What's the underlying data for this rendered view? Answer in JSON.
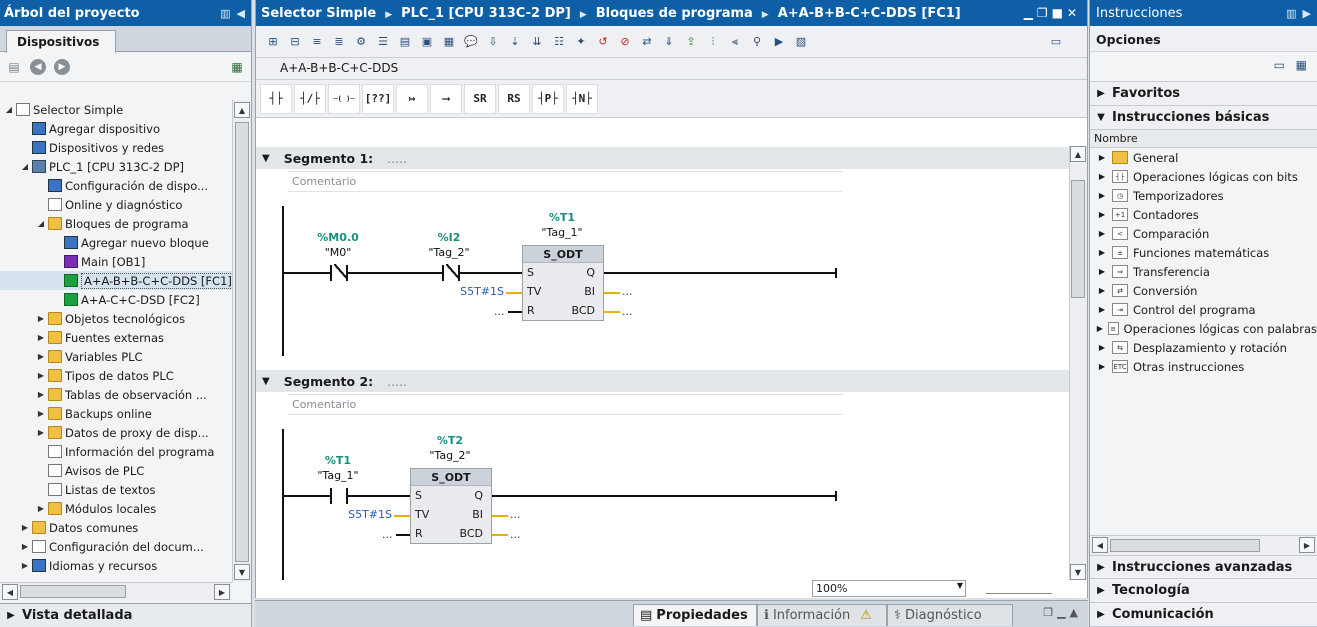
{
  "project_tree": {
    "title": "Árbol del proyecto",
    "tab": "Dispositivos",
    "items": [
      {
        "label": "Selector Simple",
        "level": 0,
        "expander": "open",
        "icon": "doc-icon"
      },
      {
        "label": "Agregar dispositivo",
        "level": 1,
        "expander": "",
        "icon": "add-device-icon"
      },
      {
        "label": "Dispositivos y redes",
        "level": 1,
        "expander": "",
        "icon": "network-icon"
      },
      {
        "label": "PLC_1 [CPU 313C-2 DP]",
        "level": 1,
        "expander": "open",
        "icon": "plc-icon"
      },
      {
        "label": "Configuración de dispo...",
        "level": 2,
        "expander": "",
        "icon": "config-icon"
      },
      {
        "label": "Online y diagnóstico",
        "level": 2,
        "expander": "",
        "icon": "diagnostics-icon"
      },
      {
        "label": "Bloques de programa",
        "level": 2,
        "expander": "open",
        "icon": "folder-icon"
      },
      {
        "label": "Agregar nuevo bloque",
        "level": 3,
        "expander": "",
        "icon": "add-block-icon"
      },
      {
        "label": "Main [OB1]",
        "level": 3,
        "expander": "",
        "icon": "ob-block-icon"
      },
      {
        "label": "A+A-B+B-C+C-DDS [FC1]",
        "level": 3,
        "expander": "",
        "icon": "fc-block-icon",
        "selected": true
      },
      {
        "label": "A+A-C+C-DSD [FC2]",
        "level": 3,
        "expander": "",
        "icon": "fc-block-icon"
      },
      {
        "label": "Objetos tecnológicos",
        "level": 2,
        "expander": "closed",
        "icon": "folder-icon"
      },
      {
        "label": "Fuentes externas",
        "level": 2,
        "expander": "closed",
        "icon": "folder-icon"
      },
      {
        "label": "Variables PLC",
        "level": 2,
        "expander": "closed",
        "icon": "folder-icon"
      },
      {
        "label": "Tipos de datos PLC",
        "level": 2,
        "expander": "closed",
        "icon": "folder-icon"
      },
      {
        "label": "Tablas de observación ...",
        "level": 2,
        "expander": "closed",
        "icon": "folder-icon"
      },
      {
        "label": "Backups online",
        "level": 2,
        "expander": "closed",
        "icon": "folder-icon"
      },
      {
        "label": "Datos de proxy de disp...",
        "level": 2,
        "expander": "closed",
        "icon": "folder-icon"
      },
      {
        "label": "Información del programa",
        "level": 2,
        "expander": "",
        "icon": "program-info-icon"
      },
      {
        "label": "Avisos de PLC",
        "level": 2,
        "expander": "",
        "icon": "alarm-icon"
      },
      {
        "label": "Listas de textos",
        "level": 2,
        "expander": "",
        "icon": "text-list-icon"
      },
      {
        "label": "Módulos locales",
        "level": 2,
        "expander": "closed",
        "icon": "folder-icon"
      },
      {
        "label": "Datos comunes",
        "level": 1,
        "expander": "closed",
        "icon": "folder-icon"
      },
      {
        "label": "Configuración del docum...",
        "level": 1,
        "expander": "closed",
        "icon": "doc-settings-icon"
      },
      {
        "label": "Idiomas y recursos",
        "level": 1,
        "expander": "closed",
        "icon": "languages-icon"
      }
    ],
    "details_view": "Vista detallada"
  },
  "editor": {
    "breadcrumb": [
      "Selector Simple",
      "PLC_1 [CPU 313C-2 DP]",
      "Bloques de programa",
      "A+A-B+B-C+C-DDS [FC1]"
    ],
    "block_name": "A+A-B+B-C+C-DDS",
    "lad_buttons": [
      "┤├",
      "┤/├",
      "─( )─",
      "[??]",
      "↦",
      "⟶",
      "SR",
      "RS",
      "┤P├",
      "┤N├"
    ],
    "comment_placeholder": "Comentario",
    "segments": [
      {
        "title": "Segmento 1:",
        "dots": ".....",
        "contacts": [
          {
            "addr": "%M0.0",
            "name": "\"M0\"",
            "type": "nc"
          },
          {
            "addr": "%I2",
            "name": "\"Tag_2\"",
            "type": "nc"
          }
        ],
        "block": {
          "addr": "%T1",
          "name": "\"Tag_1\"",
          "title": "S_ODT",
          "pins": [
            [
              "S",
              "Q"
            ],
            [
              "TV",
              "BI"
            ],
            [
              "R",
              "BCD"
            ]
          ],
          "tv": "S5T#1S",
          "r": "...",
          "bi": "...",
          "bcd": "..."
        }
      },
      {
        "title": "Segmento 2:",
        "dots": ".....",
        "contacts": [
          {
            "addr": "%T1",
            "name": "\"Tag_1\"",
            "type": "no"
          }
        ],
        "block": {
          "addr": "%T2",
          "name": "\"Tag_2\"",
          "title": "S_ODT",
          "pins": [
            [
              "S",
              "Q"
            ],
            [
              "TV",
              "BI"
            ],
            [
              "R",
              "BCD"
            ]
          ],
          "tv": "S5T#1S",
          "r": "...",
          "bi": "...",
          "bcd": "..."
        }
      }
    ],
    "zoom": "100%"
  },
  "bottom_tabs": [
    "Propiedades",
    "Información",
    "Diagnóstico"
  ],
  "instructions": {
    "title": "Instrucciones",
    "options": "Opciones",
    "favorites": "Favoritos",
    "basic": "Instrucciones básicas",
    "column": "Nombre",
    "items": [
      {
        "label": "General",
        "icon": "folder-icon"
      },
      {
        "label": "Operaciones lógicas con bits",
        "icon": "bit-logic-icon"
      },
      {
        "label": "Temporizadores",
        "icon": "timer-icon"
      },
      {
        "label": "Contadores",
        "icon": "counter-icon"
      },
      {
        "label": "Comparación",
        "icon": "compare-icon"
      },
      {
        "label": "Funciones matemáticas",
        "icon": "math-icon"
      },
      {
        "label": "Transferencia",
        "icon": "move-icon"
      },
      {
        "label": "Conversión",
        "icon": "convert-icon"
      },
      {
        "label": "Control del programa",
        "icon": "program-control-icon"
      },
      {
        "label": "Operaciones lógicas con palabras",
        "icon": "word-logic-icon"
      },
      {
        "label": "Desplazamiento y rotación",
        "icon": "shift-icon"
      },
      {
        "label": "Otras instrucciones",
        "icon": "etc-icon"
      }
    ],
    "advanced": "Instrucciones avanzadas",
    "technology": "Tecnología",
    "communication": "Comunicación"
  },
  "colors": {
    "titlebar": "#0f5fa7",
    "tag_addr": "#1a8f80",
    "constant": "#2a5bb0",
    "pin_line": "#e8b000"
  }
}
